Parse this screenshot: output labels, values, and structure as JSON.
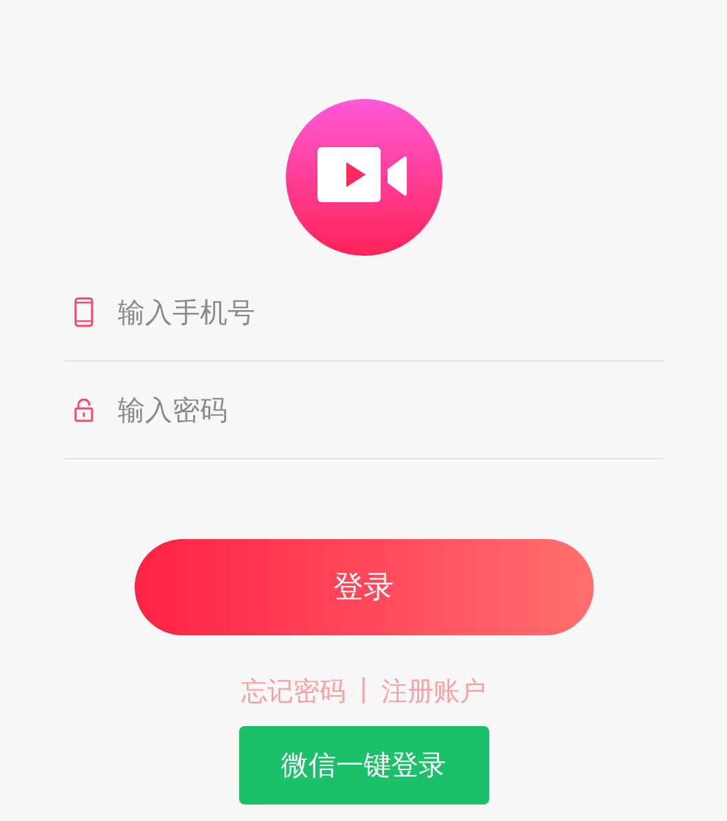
{
  "fields": [
    {
      "kind": "phone",
      "placeholder": "输入手机号"
    },
    {
      "kind": "password",
      "placeholder": "输入密码"
    }
  ],
  "login_button": "登录",
  "links": [
    "忘记密码",
    "|",
    "注册账户"
  ],
  "wechat_button": "微信一键登录"
}
